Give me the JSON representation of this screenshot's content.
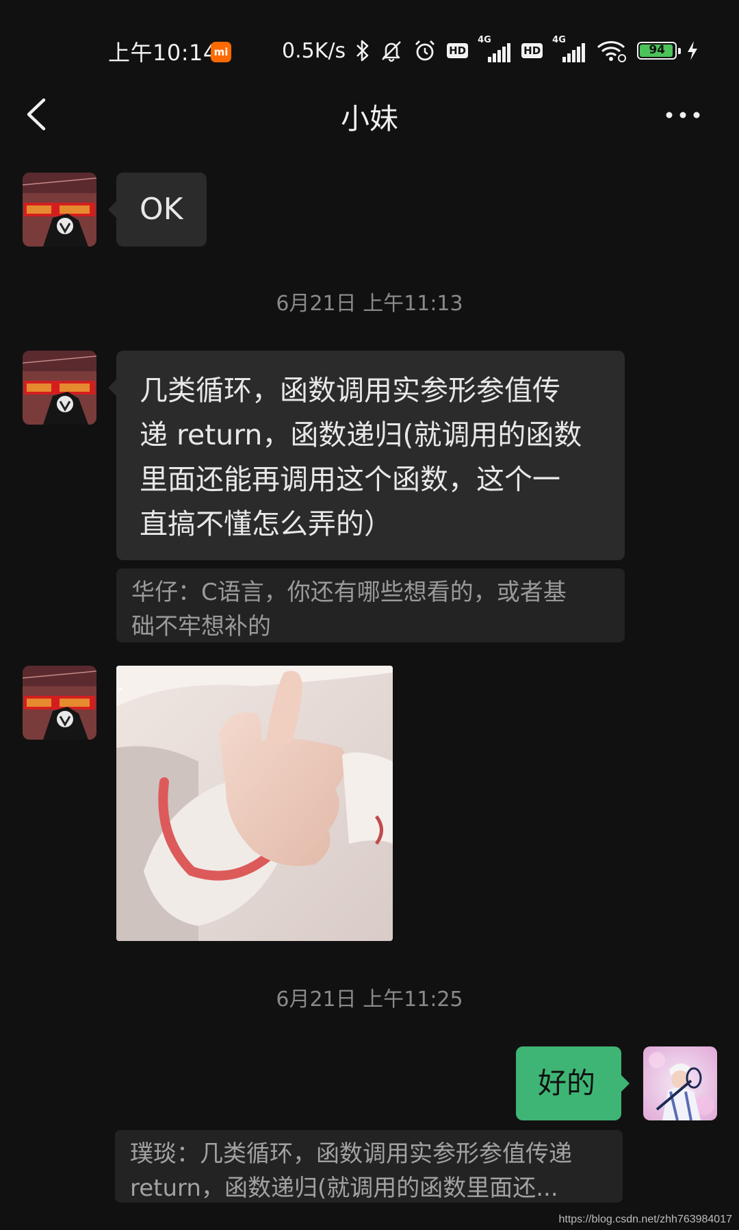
{
  "status_bar": {
    "time": "上午10:14",
    "mi_badge": "mi",
    "net_speed": "0.5K/s",
    "icons": [
      "bluetooth-icon",
      "mute-bell-icon",
      "alarm-icon",
      "hd-icon",
      "signal-4g-icon",
      "hd-icon",
      "signal-4g-icon",
      "wifi-icon",
      "battery-icon",
      "charging-icon"
    ],
    "hd_label": "HD",
    "network_label": "4G",
    "battery_level": "94"
  },
  "nav": {
    "title": "小妹",
    "back_icon": "chevron-left-icon",
    "more_icon": "more-dots-icon"
  },
  "messages": [
    {
      "type": "text",
      "from": "other",
      "text": "OK"
    },
    {
      "type": "timestamp",
      "text": "6月21日 上午11:13"
    },
    {
      "type": "text",
      "from": "other",
      "lines": [
        "几类循环，函数调用实参形参值传",
        "递 return，函数递归(就调用的函数",
        "里面还能再调用这个函数，这个一",
        "直搞不懂怎么弄的）"
      ],
      "quote_lines": [
        "华仔：C语言，你还有哪些想看的，或者基",
        "础不牢想补的"
      ]
    },
    {
      "type": "image",
      "from": "other",
      "image_desc": "thumbs-up sticker"
    },
    {
      "type": "timestamp",
      "text": "6月21日 上午11:25"
    },
    {
      "type": "text",
      "from": "me",
      "text": "好的",
      "quote_lines": [
        "璞琰：几类循环，函数调用实参形参值传递",
        "return，函数递归(就调用的函数里面还..."
      ]
    }
  ],
  "watermark": "https://blog.csdn.net/zhh763984017",
  "colors": {
    "background": "#111111",
    "bubble_in": "#2b2b2b",
    "bubble_out": "#3eb575",
    "battery": "#4cc35a",
    "mi_orange": "#ff6a00"
  }
}
